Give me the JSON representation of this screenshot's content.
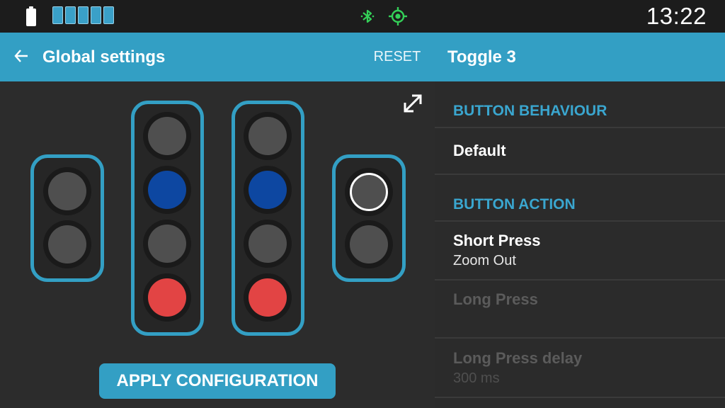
{
  "status_bar": {
    "time": "13:22",
    "icons": [
      "battery-icon",
      "signal-bars-icon",
      "bluetooth-icon",
      "gps-icon"
    ],
    "status_color": "#34d058"
  },
  "app_bar": {
    "title": "Global settings",
    "reset_label": "RESET",
    "panel_title": "Toggle 3",
    "accent_color": "#339fc4"
  },
  "main": {
    "expand_icon": "expand-icon",
    "button_groups": [
      {
        "name": "group-left",
        "buttons": [
          "gray",
          "gray"
        ]
      },
      {
        "name": "group-center-left",
        "buttons": [
          "gray",
          "blue",
          "gray",
          "red"
        ]
      },
      {
        "name": "group-center-right",
        "buttons": [
          "gray",
          "blue",
          "gray",
          "red"
        ]
      },
      {
        "name": "group-right",
        "buttons": [
          "gray-selected",
          "gray"
        ]
      }
    ],
    "apply_label": "APPLY CONFIGURATION"
  },
  "side_panel": {
    "button_behaviour_header": "BUTTON BEHAVIOUR",
    "behaviour_value": "Default",
    "button_action_header": "BUTTON ACTION",
    "short_press_label": "Short Press",
    "short_press_value": "Zoom Out",
    "long_press_label": "Long Press",
    "long_press_delay_label": "Long Press delay",
    "long_press_delay_value": "300 ms"
  }
}
